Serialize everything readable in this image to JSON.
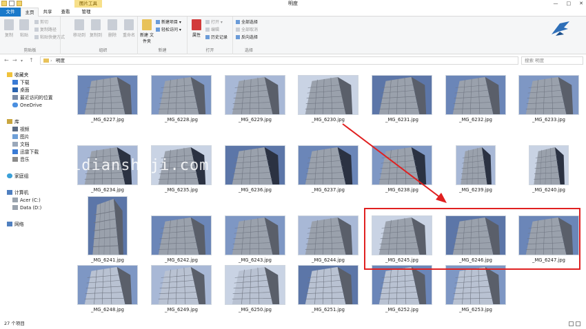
{
  "window": {
    "title": "明度",
    "contextual_tab": "图片工具"
  },
  "tabs": [
    "文件",
    "主页",
    "共享",
    "查看",
    "管理"
  ],
  "ribbon": {
    "clipboard": {
      "label": "剪贴板",
      "copy": "复制",
      "paste": "粘贴",
      "cut": "剪切",
      "copy_path": "复制路径",
      "paste_shortcut": "粘贴快捷方式"
    },
    "organize": {
      "label": "组织",
      "move_to": "移动到",
      "copy_to": "复制到",
      "delete": "删除",
      "rename": "重命名"
    },
    "new": {
      "label": "新建",
      "new_folder": "新建\n文件夹",
      "new_item": "新建项目 ▾",
      "easy_access": "轻松访问 ▾"
    },
    "open": {
      "label": "打开",
      "properties": "属性",
      "open": "打开 ▾",
      "edit": "编辑",
      "history": "历史记录"
    },
    "select": {
      "label": "选择",
      "select_all": "全部选择",
      "select_none": "全部取消",
      "invert": "反向选择"
    }
  },
  "address": {
    "path": "明度",
    "search_placeholder": "搜索 明度"
  },
  "navpane": {
    "favorites": "收藏夹",
    "fav_items": [
      "下载",
      "桌面",
      "最近访问的位置",
      "OneDrive"
    ],
    "libraries": "库",
    "lib_items": [
      "视频",
      "图片",
      "文档",
      "迅雷下载",
      "音乐"
    ],
    "homegroup": "家庭组",
    "computer": "计算机",
    "drives": [
      "Acer (C:)",
      "Data (D:)"
    ],
    "network": "网络"
  },
  "files": [
    "_MG_6227.jpg",
    "_MG_6228.jpg",
    "_MG_6229.jpg",
    "_MG_6230.jpg",
    "_MG_6231.jpg",
    "_MG_6232.jpg",
    "_MG_6233.jpg",
    "_MG_6234.jpg",
    "_MG_6235.jpg",
    "_MG_6236.jpg",
    "_MG_6237.jpg",
    "_MG_6238.jpg",
    "_MG_6239.jpg",
    "_MG_6240.jpg",
    "_MG_6241.jpg",
    "_MG_6242.jpg",
    "_MG_6243.jpg",
    "_MG_6244.jpg",
    "_MG_6245.jpg",
    "_MG_6246.jpg",
    "_MG_6247.jpg",
    "_MG_6248.jpg",
    "_MG_6249.jpg",
    "_MG_6250.jpg",
    "_MG_6251.jpg",
    "_MG_6252.jpg",
    "_MG_6253.jpg"
  ],
  "watermark": "idianshiji.com",
  "status": {
    "count": "27 个项目"
  },
  "colors": {
    "file_tab": "#1979ca",
    "highlight": "#e02020",
    "arrow": "#e02020"
  }
}
